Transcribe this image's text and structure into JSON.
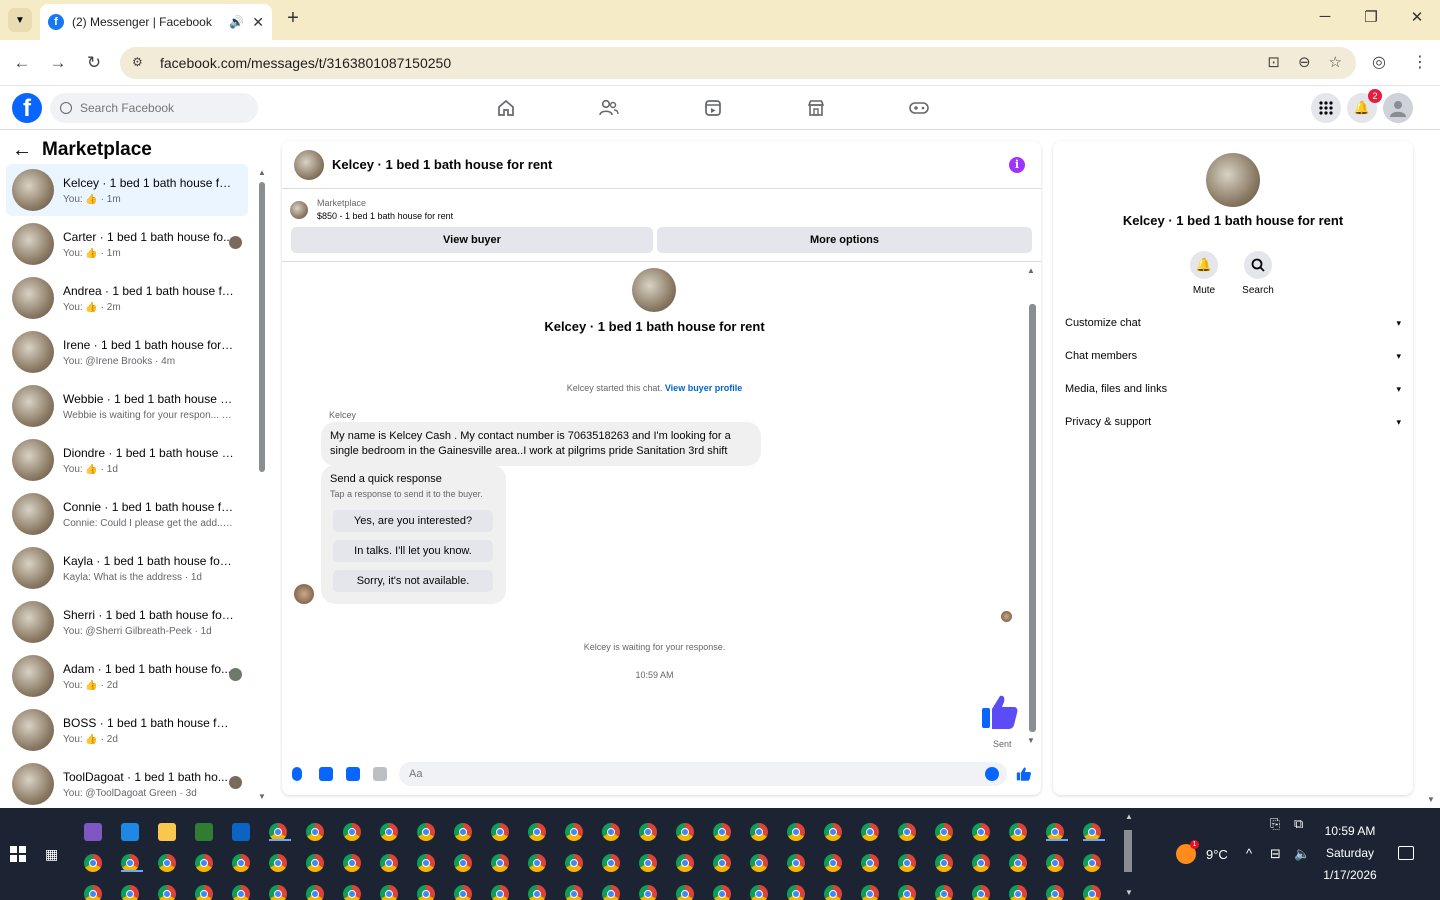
{
  "browser": {
    "tab_title": "(2) Messenger | Facebook",
    "url": "facebook.com/messages/t/3163801087150250"
  },
  "fb": {
    "search_placeholder": "Search Facebook",
    "notification_count": "2",
    "brand_color": "#0866ff"
  },
  "left": {
    "title": "Marketplace",
    "conversations": [
      {
        "name": "Kelcey · 1 bed 1 bath house for r...",
        "preview": "You: 👍 · 1m",
        "active": true
      },
      {
        "name": "Carter · 1 bed 1 bath house fo...",
        "preview": "You: 👍 · 1m"
      },
      {
        "name": "Andrea · 1 bed 1 bath house for ...",
        "preview": "You: 👍 · 2m"
      },
      {
        "name": "Irene · 1 bed 1 bath house for re...",
        "preview": "You: @Irene Brooks · 4m"
      },
      {
        "name": "Webbie · 1 bed 1 bath house for...",
        "preview": "Webbie is waiting for your respon... · 4h"
      },
      {
        "name": "Diondre · 1 bed 1 bath house fo...",
        "preview": "You: 👍 · 1d"
      },
      {
        "name": "Connie · 1 bed 1 bath house for ...",
        "preview": "Connie: Could I please get the add... · 1d"
      },
      {
        "name": "Kayla · 1 bed 1 bath house for r...",
        "preview": "Kayla: What is the address · 1d"
      },
      {
        "name": "Sherri · 1 bed 1 bath house for r...",
        "preview": "You: @Sherri Gilbreath-Peek · 1d"
      },
      {
        "name": "Adam · 1 bed 1 bath house fo...",
        "preview": "You: 👍 · 2d"
      },
      {
        "name": "BOSS · 1 bed 1 bath house for r...",
        "preview": "You: 👍 · 2d"
      },
      {
        "name": "ToolDagoat · 1 bed 1 bath ho...",
        "preview": "You: @ToolDagoat Green · 3d"
      }
    ]
  },
  "chat": {
    "title": "Kelcey · 1 bed 1 bath house for rent",
    "marketplace_label": "Marketplace",
    "listing": "$850 - 1 bed 1 bath house for rent",
    "view_buyer": "View buyer",
    "more_options": "More options",
    "intro_title": "Kelcey · 1 bed 1 bath house for rent",
    "started_text": "Kelcey started this chat.",
    "buyer_profile_link": "View buyer profile",
    "sender": "Kelcey",
    "message": "My name is Kelcey Cash . My contact number is 7063518263 and I'm looking for a single bedroom in the Gainesville area..I work at pilgrims pride Sanitation 3rd shift",
    "quick_title": "Send a quick response",
    "quick_subtitle": "Tap a response to send it to the buyer.",
    "quick_responses": [
      "Yes, are you interested?",
      "In talks. I'll let you know.",
      "Sorry, it's not available."
    ],
    "waiting_text": "Kelcey is waiting for your response.",
    "time": "10:59 AM",
    "sent_label": "Sent",
    "composer_placeholder": "Aa"
  },
  "info": {
    "title": "Kelcey · 1 bed 1 bath house for rent",
    "mute": "Mute",
    "search": "Search",
    "sections": [
      "Customize chat",
      "Chat members",
      "Media, files and links",
      "Privacy & support"
    ]
  },
  "taskbar": {
    "temperature": "9°C",
    "weather_badge": "1",
    "time": "10:59 AM",
    "day": "Saturday",
    "date": "1/17/2026"
  }
}
